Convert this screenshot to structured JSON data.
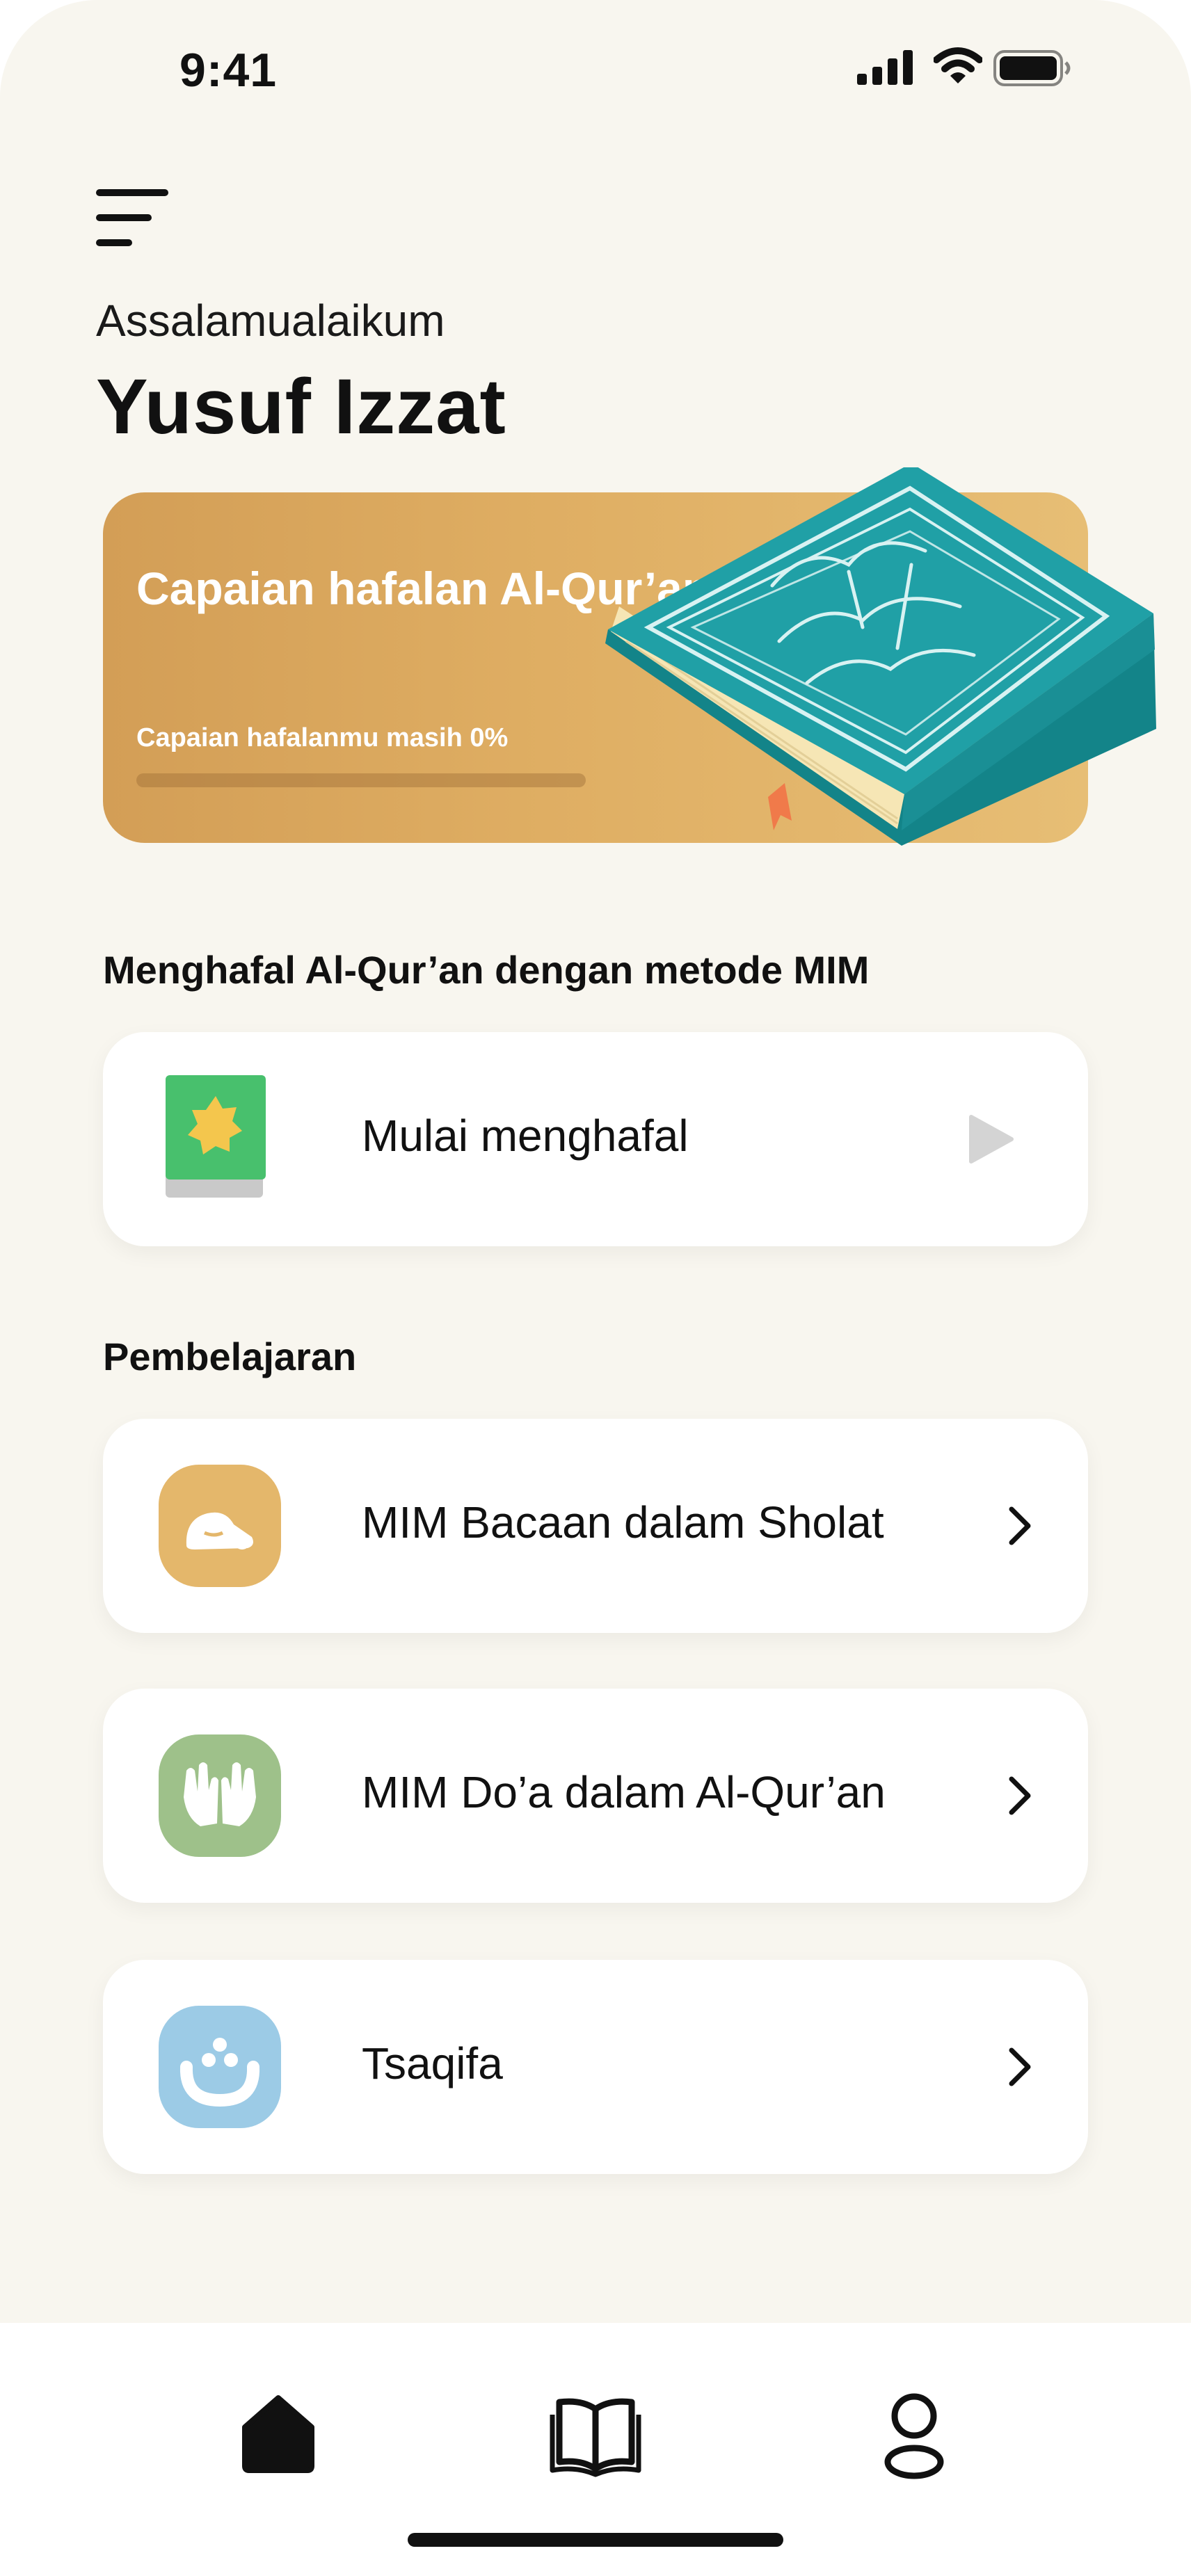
{
  "status_bar": {
    "time": "9:41"
  },
  "header": {
    "greeting": "Assalamualaikum",
    "user_name": "Yusuf Izzat"
  },
  "progress_card": {
    "title": "Capaian hafalan Al-Qur’an",
    "subtitle": "Capaian hafalanmu masih 0%",
    "progress": 0
  },
  "memorize_section": {
    "title": "Menghafal Al-Qur’an dengan metode MIM",
    "start_label": "Mulai menghafal"
  },
  "learning_section": {
    "title": "Pembelajaran",
    "items": [
      {
        "label": "MIM Bacaan dalam Sholat",
        "icon": "prostration-icon",
        "color": "#e4b76b"
      },
      {
        "label": "MIM Do’a dalam Al-Qur’an",
        "icon": "praying-hands-icon",
        "color": "#9ec18a"
      },
      {
        "label": "Tsaqifa",
        "icon": "arabic-letter-icon",
        "color": "#9ccbe6"
      }
    ]
  },
  "bottom_nav": {
    "items": [
      {
        "icon": "home-icon",
        "active": true
      },
      {
        "icon": "book-icon",
        "active": false
      },
      {
        "icon": "profile-icon",
        "active": false
      }
    ]
  },
  "colors": {
    "background": "#f8f6ef",
    "card_gradient_start": "#d39e56",
    "card_gradient_end": "#e7be75",
    "quran_teal": "#1e9aa0"
  }
}
